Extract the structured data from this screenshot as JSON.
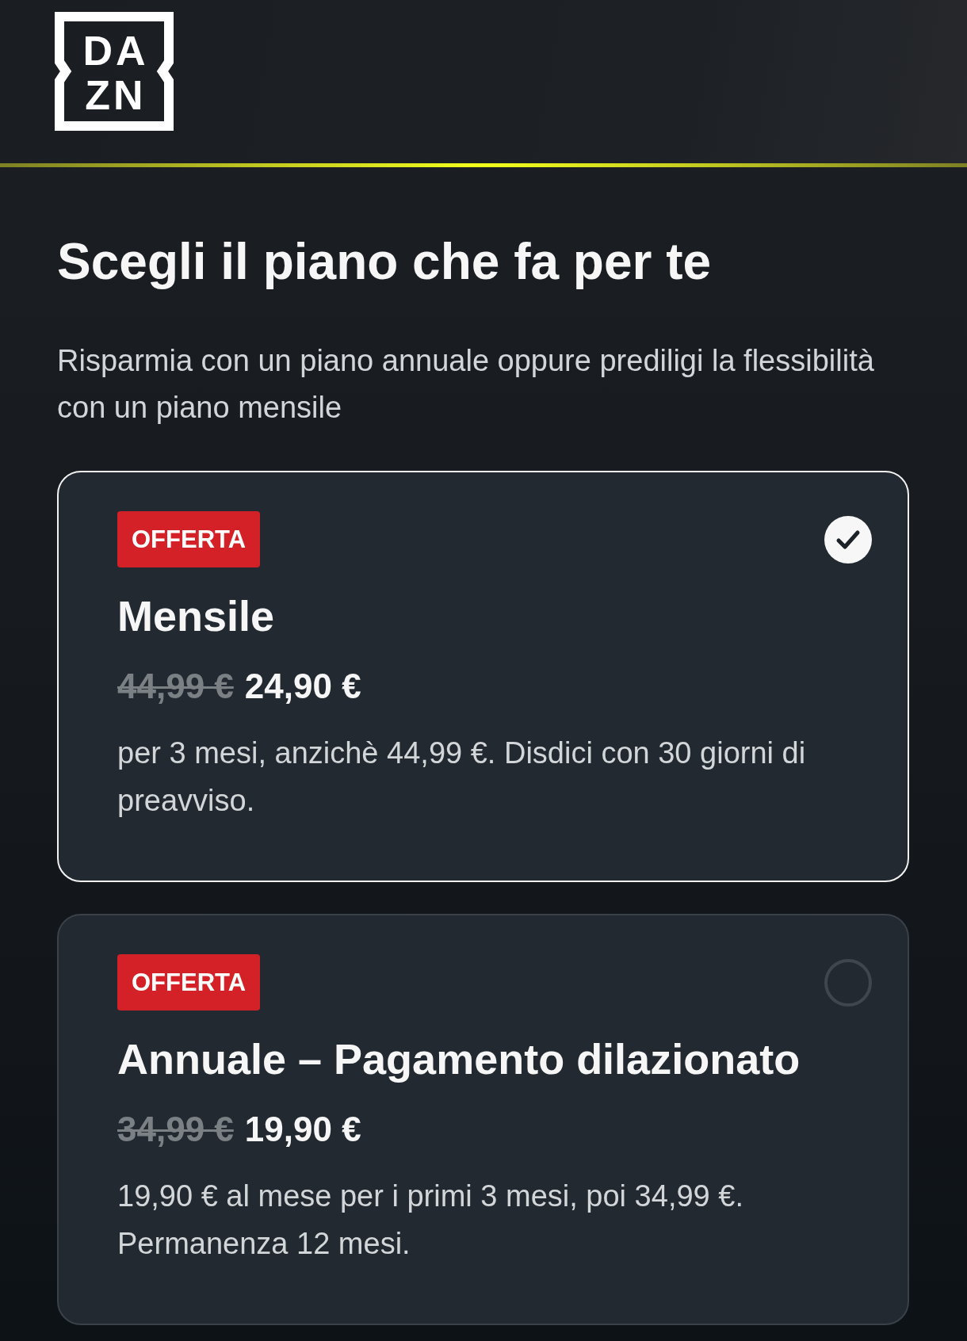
{
  "header": {
    "logo": {
      "lines": [
        "DA",
        "ZN"
      ]
    }
  },
  "heading": "Scegli il piano che fa per te",
  "subheading": "Risparmia con un piano annuale oppure prediligi la flessibilità con un piano mensile",
  "plans": [
    {
      "badge": "OFFERTA",
      "name": "Mensile",
      "old_price": "44,99 €",
      "price": "24,90 €",
      "description": "per 3 mesi, anzichè 44,99 €. Disdici con 30 giorni di preavviso.",
      "selected": true
    },
    {
      "badge": "OFFERTA",
      "name": "Annuale – Pagamento dilazionato",
      "old_price": "34,99 €",
      "price": "19,90 €",
      "description": "19,90 € al mese per i primi 3 mesi, poi 34,99 €. Permanenza 12 mesi.",
      "selected": false
    }
  ]
}
